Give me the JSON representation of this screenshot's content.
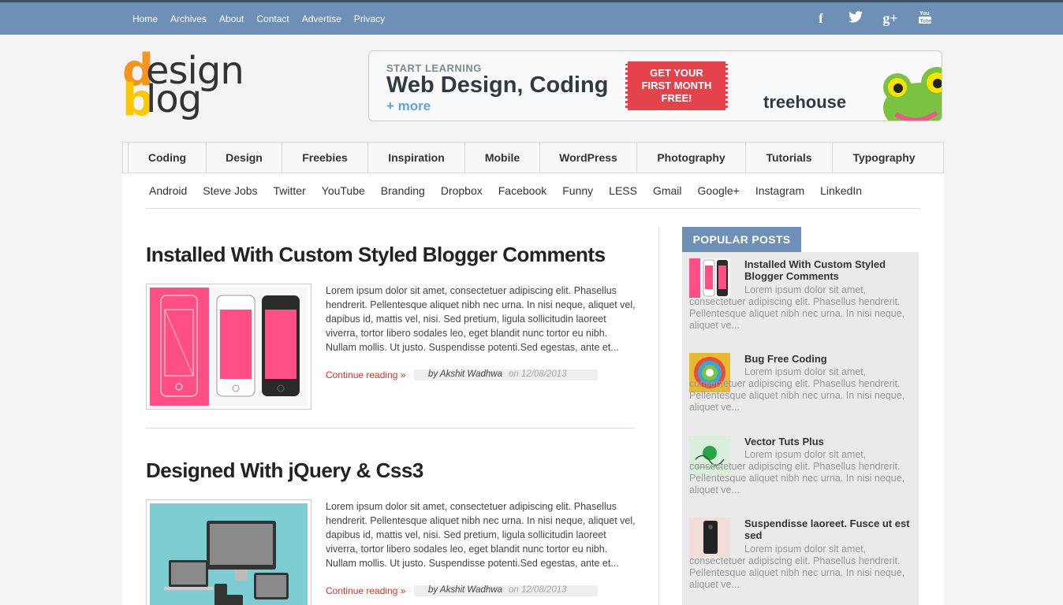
{
  "topnav": {
    "items": [
      "Home",
      "Archives",
      "About",
      "Contact",
      "Advertise",
      "Privacy"
    ]
  },
  "social": {
    "items": [
      {
        "name": "facebook-icon",
        "glyph": "f"
      },
      {
        "name": "twitter-icon",
        "glyph": "🐦"
      },
      {
        "name": "google-plus-icon",
        "glyph": "g+"
      },
      {
        "name": "youtube-icon",
        "glyph": "▶"
      }
    ]
  },
  "logo": {
    "d": "d",
    "esign": "esign",
    "b": "b",
    "log": "log"
  },
  "banner": {
    "start": "START LEARNING",
    "headline": "Web Design, Coding",
    "more": "+ more",
    "cta_line1": "GET YOUR",
    "cta_line2": "FIRST MONTH",
    "cta_line3": "FREE!",
    "brand": "treehouse"
  },
  "categories": [
    "Coding",
    "Design",
    "Freebies",
    "Inspiration",
    "Mobile",
    "WordPress",
    "Photography",
    "Tutorials",
    "Typography"
  ],
  "tags": [
    "Android",
    "Steve Jobs",
    "Twitter",
    "YouTube",
    "Branding",
    "Dropbox",
    "Facebook",
    "Funny",
    "LESS",
    "Gmail",
    "Google+",
    "Instagram",
    "LinkedIn"
  ],
  "posts": [
    {
      "title": "Installed With Custom Styled Blogger Comments",
      "excerpt": "Lorem ipsum dolor sit amet, consectetuer adipiscing elit. Phasellus hendrerit. Pellentesque aliquet nibh nec urna. In nisi neque, aliquet vel, dapibus id, mattis vel, nisi. Sed pretium, ligula sollicitudin laoreet viverra, tortor libero sodales leo, eget blandit nunc tortor eu nibh. Nullam mollis. Ut justo. Suspendisse potenti.Sed egestas, ante et...",
      "continue": "Continue reading »",
      "author": "by Akshit Wadhwa",
      "date": "on 12/08/2013"
    },
    {
      "title": "Designed With jQuery & Css3",
      "excerpt": "Lorem ipsum dolor sit amet, consectetuer adipiscing elit. Phasellus hendrerit. Pellentesque aliquet nibh nec urna. In nisi neque, aliquet vel, dapibus id, mattis vel, nisi. Sed pretium, ligula sollicitudin laoreet viverra, tortor libero sodales leo, eget blandit nunc tortor eu nibh. Nullam mollis. Ut justo. Suspendisse potenti.Sed egestas, ante et...",
      "continue": "Continue reading »",
      "author": "by Akshit Wadhwa",
      "date": "on 12/08/2013"
    }
  ],
  "sidebar": {
    "heading": "POPULAR POSTS",
    "items": [
      {
        "title": "Installed With Custom Styled Blogger Comments",
        "desc": "Lorem ipsum dolor sit amet, consectetuer adipiscing elit. Phasellus hendrerit. Pellentesque aliquet nibh nec urna. In nisi neque, aliquet ve..."
      },
      {
        "title": "Bug Free Coding",
        "desc": "Lorem ipsum dolor sit amet, consectetuer adipiscing elit. Phasellus hendrerit. Pellentesque aliquet nibh nec urna. In nisi neque, aliquet ve..."
      },
      {
        "title": "Vector Tuts Plus",
        "desc": "Lorem ipsum dolor sit amet, consectetuer adipiscing elit. Phasellus hendrerit. Pellentesque aliquet nibh nec urna. In nisi neque, aliquet ve..."
      },
      {
        "title": "Suspendisse laoreet. Fusce ut est sed",
        "desc": "Lorem ipsum dolor sit amet, consectetuer adipiscing elit. Phasellus hendrerit. Pellentesque aliquet nibh nec urna. In nisi neque, aliquet ve..."
      }
    ]
  },
  "colors": {
    "topbar": "#6e8fb6",
    "accent_red": "#d2322d",
    "logo_orange": "#f7941d",
    "logo_yellow": "#f9c800"
  }
}
